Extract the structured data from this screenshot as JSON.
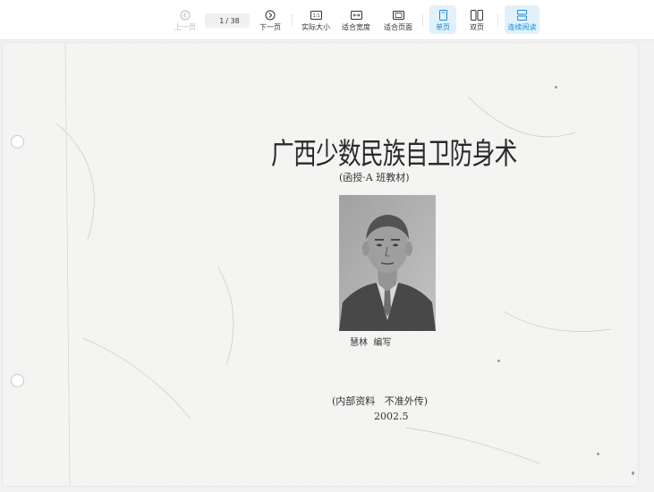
{
  "toolbar": {
    "prev_label": "上一页",
    "next_label": "下一页",
    "page_current": "1",
    "page_total": "/ 38",
    "actual_size_label": "实际大小",
    "fit_width_label": "适合宽度",
    "fit_page_label": "适合页面",
    "single_page_label": "单页",
    "double_page_label": "双页",
    "continuous_label": "连续阅读"
  },
  "document": {
    "title": "广西少数民族自卫防身术",
    "subtitle": "(函授·A 班教材)",
    "author": "慧林  编写",
    "notice": "(内部资料   不准外传)",
    "date": "2002.5"
  },
  "colors": {
    "accent": "#1c8ad6",
    "active_bg": "#e2f0fb",
    "disabled": "#bbbbbb"
  }
}
